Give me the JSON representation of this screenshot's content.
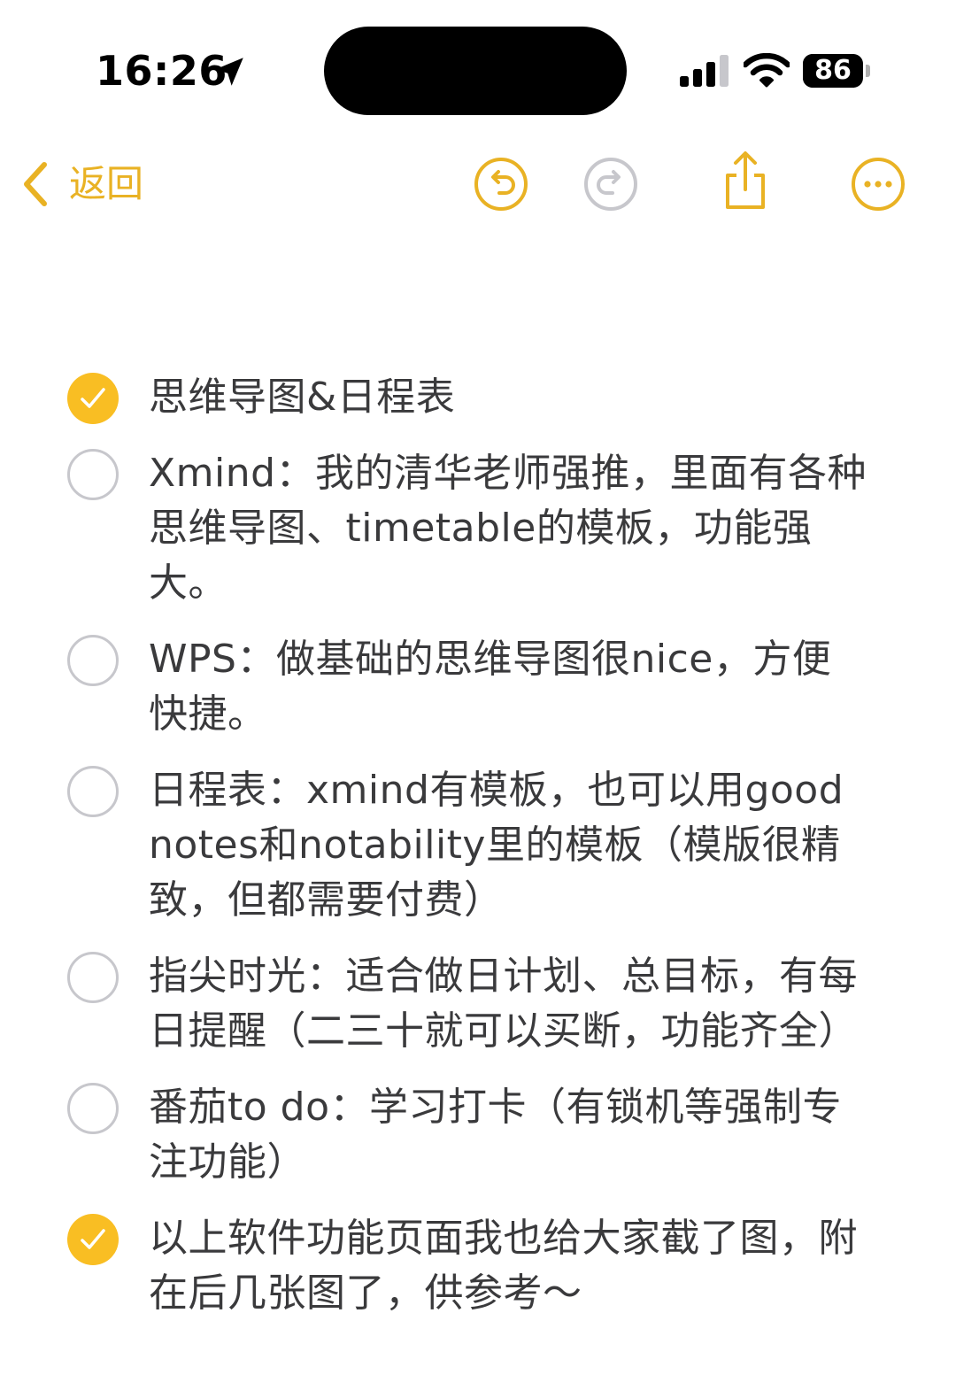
{
  "status_bar": {
    "time": "16:26",
    "battery_level": "86",
    "battery_percent": 86,
    "icons": [
      "location-arrow-icon",
      "cellular-signal-icon",
      "wifi-icon",
      "battery-icon"
    ]
  },
  "toolbar": {
    "back_label": "返回",
    "icons": [
      "chevron-left-icon",
      "undo-icon",
      "redo-icon",
      "share-icon",
      "more-icon"
    ],
    "undo_enabled": true,
    "redo_enabled": false
  },
  "colors": {
    "accent": "#e9b224",
    "check_fill": "#f9be23",
    "unchecked_border": "#c7c7cc",
    "disabled_icon": "#c7c7cc",
    "text": "#3a3a3c"
  },
  "checklist": [
    {
      "checked": true,
      "text": "思维导图&日程表"
    },
    {
      "checked": false,
      "text": "Xmind：我的清华老师强推，里面有各种思维导图、timetable的模板，功能强大。"
    },
    {
      "checked": false,
      "text": "WPS：做基础的思维导图很nice，方便快捷。"
    },
    {
      "checked": false,
      "text": "日程表：xmind有模板，也可以用goodnotes和notability里的模板（模版很精致，但都需要付费）"
    },
    {
      "checked": false,
      "text": "指尖时光：适合做日计划、总目标，有每日提醒（二三十就可以买断，功能齐全）"
    },
    {
      "checked": false,
      "text": "番茄to do：学习打卡（有锁机等强制专注功能）"
    },
    {
      "checked": true,
      "text": "以上软件功能页面我也给大家截了图，附在后几张图了，供参考～"
    }
  ]
}
